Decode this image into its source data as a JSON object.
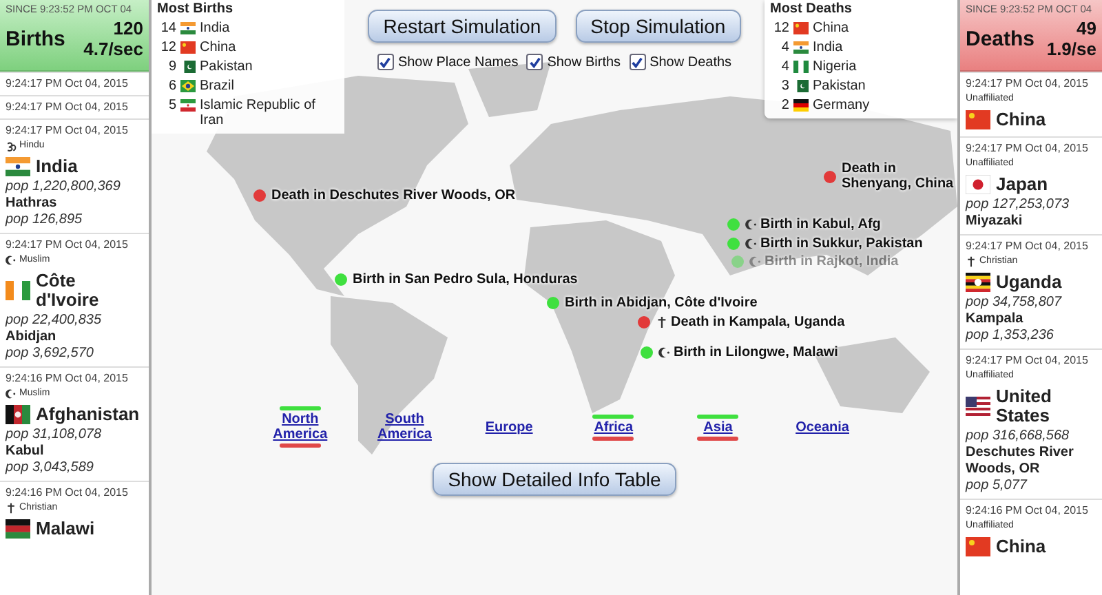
{
  "births_panel": {
    "since": "SINCE 9:23:52 PM OCT 04",
    "title": "Births",
    "count": "120",
    "rate": "4.7/sec",
    "feed": [
      {
        "time": "9:24:17 PM Oct 04, 2015"
      },
      {
        "time": "9:24:17 PM Oct 04, 2015"
      },
      {
        "time": "9:24:17 PM Oct 04, 2015",
        "religion": {
          "kind": "om",
          "label": "Hindu"
        },
        "flag": {
          "kind": "in"
        },
        "country": "India",
        "country_pop": "pop 1,220,800,369",
        "city": "Hathras",
        "city_pop": "pop 126,895"
      },
      {
        "time": "9:24:17 PM Oct 04, 2015",
        "religion": {
          "kind": "crescent",
          "label": "Muslim"
        },
        "flag": {
          "kind": "ci"
        },
        "country": "Côte d'Ivoire",
        "country_pop": "pop 22,400,835",
        "city": "Abidjan",
        "city_pop": "pop 3,692,570"
      },
      {
        "time": "9:24:16 PM Oct 04, 2015",
        "religion": {
          "kind": "crescent",
          "label": "Muslim"
        },
        "flag": {
          "kind": "af"
        },
        "country": "Afghanistan",
        "country_pop": "pop 31,108,078",
        "city": "Kabul",
        "city_pop": "pop 3,043,589"
      },
      {
        "time": "9:24:16 PM Oct 04, 2015",
        "religion": {
          "kind": "cross",
          "label": "Christian"
        },
        "flag": {
          "kind": "mw"
        },
        "country": "Malawi"
      }
    ]
  },
  "most_births": {
    "title": "Most Births",
    "items": [
      {
        "count": "14",
        "flag": {
          "kind": "in"
        },
        "country": "India"
      },
      {
        "count": "12",
        "flag": {
          "kind": "cn"
        },
        "country": "China"
      },
      {
        "count": "9",
        "flag": {
          "kind": "pk"
        },
        "country": "Pakistan"
      },
      {
        "count": "6",
        "flag": {
          "kind": "br"
        },
        "country": "Brazil"
      },
      {
        "count": "5",
        "flag": {
          "kind": "ir"
        },
        "country": "Islamic Republic of Iran"
      }
    ]
  },
  "buttons": [
    "Restart Simulation",
    "Stop Simulation"
  ],
  "checkboxes": [
    {
      "label": "Show Place Names",
      "checked": true
    },
    {
      "label": "Show Births",
      "checked": true
    },
    {
      "label": "Show Deaths",
      "checked": true
    }
  ],
  "most_deaths": {
    "title": "Most Deaths",
    "items": [
      {
        "count": "12",
        "flag": {
          "kind": "cn"
        },
        "country": "China"
      },
      {
        "count": "4",
        "flag": {
          "kind": "in"
        },
        "country": "India"
      },
      {
        "count": "4",
        "flag": {
          "kind": "ng"
        },
        "country": "Nigeria"
      },
      {
        "count": "3",
        "flag": {
          "kind": "pk"
        },
        "country": "Pakistan"
      },
      {
        "count": "2",
        "flag": {
          "kind": "de"
        },
        "country": "Germany"
      }
    ]
  },
  "pins": [
    {
      "kind": "death",
      "label": "Death in Deschutes River Woods, OR",
      "faded": false
    },
    {
      "kind": "death",
      "label": "Death in Shenyang, China",
      "faded": false
    },
    {
      "kind": "birth",
      "religion_icon": {
        "kind": "crescent"
      },
      "label": "Birth in Kabul, Afg",
      "faded": false
    },
    {
      "kind": "birth",
      "religion_icon": {
        "kind": "crescent"
      },
      "label": "Birth in Sukkur, Pakistan",
      "faded": false
    },
    {
      "kind": "birth",
      "religion_icon": {
        "kind": "crescent"
      },
      "label": "Birth in Rajkot, India",
      "faded": true
    },
    {
      "kind": "birth",
      "label": "Birth in San Pedro Sula, Honduras",
      "faded": false
    },
    {
      "kind": "birth",
      "label": "Birth in Abidjan, Côte d'Ivoire",
      "faded": false
    },
    {
      "kind": "death",
      "religion_icon": {
        "kind": "cross"
      },
      "label": "Death in Kampala, Uganda",
      "faded": false
    },
    {
      "kind": "birth",
      "religion_icon": {
        "kind": "crescent"
      },
      "label": "Birth in Lilongwe, Malawi",
      "faded": false
    }
  ],
  "continents": [
    {
      "label": "North America",
      "births": true,
      "deaths": true
    },
    {
      "label": "South America",
      "births": false,
      "deaths": false
    },
    {
      "label": "Europe",
      "births": false,
      "deaths": false
    },
    {
      "label": "Africa",
      "births": true,
      "deaths": true
    },
    {
      "label": "Asia",
      "births": true,
      "deaths": true
    },
    {
      "label": "Oceania",
      "births": false,
      "deaths": false
    }
  ],
  "info_button": "Show Detailed Info Table",
  "deaths_panel": {
    "since": "SINCE 9:23:52 PM OCT 04",
    "title": "Deaths",
    "count": "49",
    "rate": "1.9/se",
    "feed": [
      {
        "time": "9:24:17 PM Oct 04, 2015",
        "religion": {
          "kind": "none",
          "label": "Unaffiliated"
        },
        "flag": {
          "kind": "cn"
        },
        "country": "China"
      },
      {
        "time": "9:24:17 PM Oct 04, 2015",
        "religion": {
          "kind": "none",
          "label": "Unaffiliated"
        },
        "flag": {
          "kind": "jp"
        },
        "country": "Japan",
        "country_pop": "pop 127,253,073",
        "city": "Miyazaki"
      },
      {
        "time": "9:24:17 PM Oct 04, 2015",
        "religion": {
          "kind": "cross",
          "label": "Christian"
        },
        "flag": {
          "kind": "ug"
        },
        "country": "Uganda",
        "country_pop": "pop 34,758,807",
        "city": "Kampala",
        "city_pop": "pop 1,353,236"
      },
      {
        "time": "9:24:17 PM Oct 04, 2015",
        "religion": {
          "kind": "none",
          "label": "Unaffiliated"
        },
        "flag": {
          "kind": "us"
        },
        "country": "United States",
        "country_pop": "pop 316,668,568",
        "city": "Deschutes River Woods, OR",
        "city_pop": "pop 5,077"
      },
      {
        "time": "9:24:16 PM Oct 04, 2015",
        "religion": {
          "kind": "none",
          "label": "Unaffiliated"
        },
        "flag": {
          "kind": "cn"
        },
        "country": "China"
      }
    ]
  }
}
